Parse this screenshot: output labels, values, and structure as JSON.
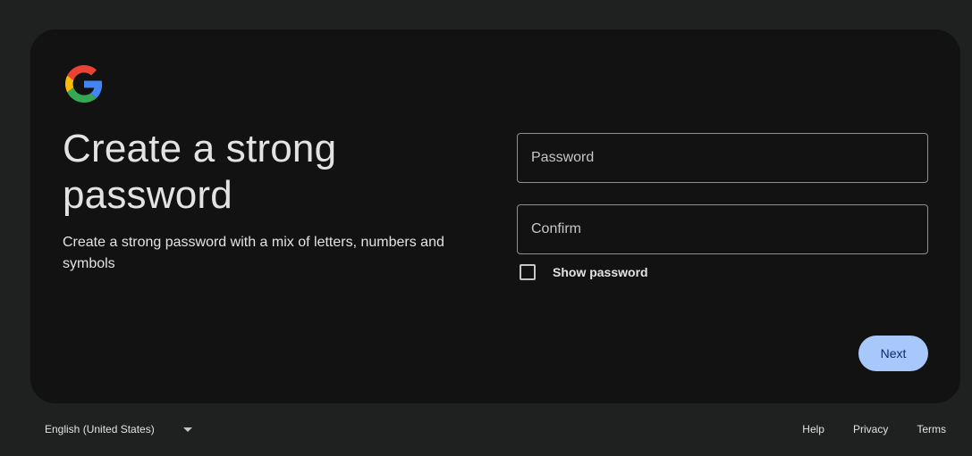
{
  "logo": {
    "icon": "google-g-logo",
    "colors": [
      "#4285F4",
      "#34A853",
      "#FBBC05",
      "#EA4335"
    ]
  },
  "heading": "Create a strong password",
  "subtext": "Create a strong password with a mix of letters, numbers and symbols",
  "fields": {
    "password": {
      "placeholder": "Password",
      "value": ""
    },
    "confirm": {
      "placeholder": "Confirm",
      "value": ""
    }
  },
  "show_password": {
    "label": "Show password",
    "checked": false
  },
  "next_button": {
    "label": "Next",
    "color": "#a8c7fa"
  },
  "footer": {
    "language": "English (United States)",
    "links": [
      "Help",
      "Privacy",
      "Terms"
    ]
  }
}
